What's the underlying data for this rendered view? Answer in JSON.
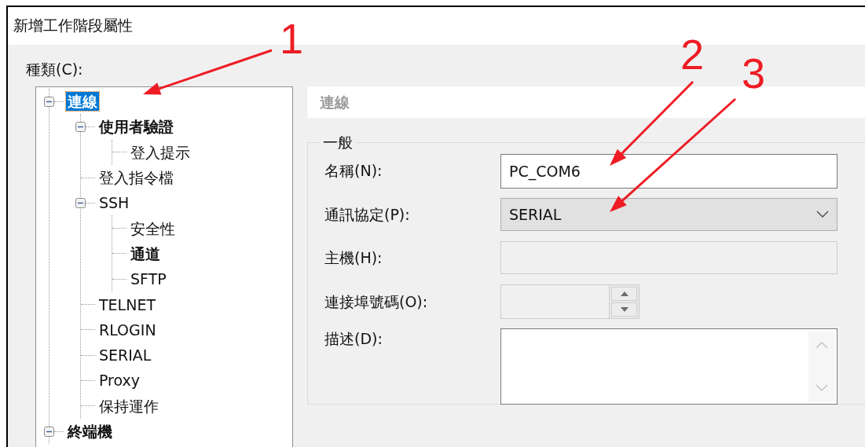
{
  "window": {
    "title": "新增工作階段屬性"
  },
  "category_label": "種類(C):",
  "tree": {
    "items": [
      {
        "label": "連線",
        "bold": true,
        "selected": true,
        "expanded": true,
        "children": [
          {
            "label": "使用者驗證",
            "bold": true,
            "selected": false,
            "expanded": true,
            "children": [
              {
                "label": "登入提示",
                "bold": false,
                "selected": false
              }
            ]
          },
          {
            "label": "登入指令檔",
            "bold": false,
            "selected": false
          },
          {
            "label": "SSH",
            "bold": false,
            "selected": false,
            "expanded": true,
            "children": [
              {
                "label": "安全性",
                "bold": false,
                "selected": false
              },
              {
                "label": "通道",
                "bold": true,
                "selected": false
              },
              {
                "label": "SFTP",
                "bold": false,
                "selected": false
              }
            ]
          },
          {
            "label": "TELNET",
            "bold": false,
            "selected": false
          },
          {
            "label": "RLOGIN",
            "bold": false,
            "selected": false
          },
          {
            "label": "SERIAL",
            "bold": false,
            "selected": false
          },
          {
            "label": "Proxy",
            "bold": false,
            "selected": false
          },
          {
            "label": "保持運作",
            "bold": false,
            "selected": false
          }
        ]
      },
      {
        "label": "終端機",
        "bold": true,
        "selected": false,
        "expanded": true
      }
    ]
  },
  "panel": {
    "header": "連線",
    "group": {
      "title": "一般",
      "fields": [
        {
          "kind": "text",
          "label": "名稱(N):",
          "value": "PC_COM6",
          "disabled": false
        },
        {
          "kind": "dropdown",
          "label": "通訊協定(P):",
          "value": "SERIAL"
        },
        {
          "kind": "text",
          "label": "主機(H):",
          "disabled": true
        },
        {
          "kind": "spin",
          "label": "連接埠號碼(O):"
        },
        {
          "kind": "textarea",
          "label": "描述(D):"
        }
      ]
    }
  },
  "annotations": [
    {
      "label": "1"
    },
    {
      "label": "2"
    },
    {
      "label": "3"
    }
  ]
}
